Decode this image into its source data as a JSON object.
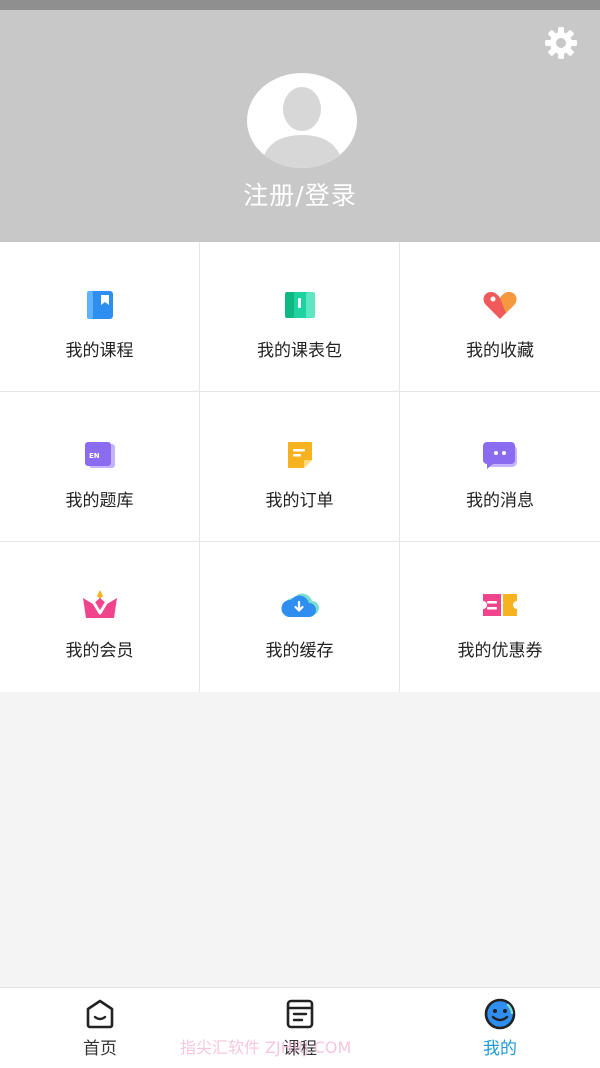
{
  "header": {
    "login_text": "注册/登录",
    "settings_icon": "gear-icon",
    "avatar_icon": "default-avatar-icon",
    "background_color": "#c8c8c8"
  },
  "grid": [
    {
      "label": "我的课程",
      "icon": "course-book-icon",
      "color": "#2f8ff0"
    },
    {
      "label": "我的课表包",
      "icon": "schedule-book-icon",
      "color": "#1fd3a0"
    },
    {
      "label": "我的收藏",
      "icon": "heart-icon",
      "color": "#f05a5a"
    },
    {
      "label": "我的题库",
      "icon": "question-bank-icon",
      "color": "#8b6cf0"
    },
    {
      "label": "我的订单",
      "icon": "order-note-icon",
      "color": "#f6b21f"
    },
    {
      "label": "我的消息",
      "icon": "message-bubble-icon",
      "color": "#8b6cf0"
    },
    {
      "label": "我的会员",
      "icon": "vip-crown-icon",
      "color": "#f0458c"
    },
    {
      "label": "我的缓存",
      "icon": "cloud-download-icon",
      "color": "#2f8ff0"
    },
    {
      "label": "我的优惠券",
      "icon": "coupon-ticket-icon",
      "color": "#f0458c"
    }
  ],
  "tabbar": [
    {
      "label": "首页",
      "icon": "home-icon",
      "active": false
    },
    {
      "label": "课程",
      "icon": "course-list-icon",
      "active": false
    },
    {
      "label": "我的",
      "icon": "profile-face-icon",
      "active": true
    }
  ],
  "colors": {
    "active_tab": "#1e9bd7",
    "page_background": "#f4f4f4"
  },
  "watermark": "指尖汇软件 ZJHRJ.COM"
}
